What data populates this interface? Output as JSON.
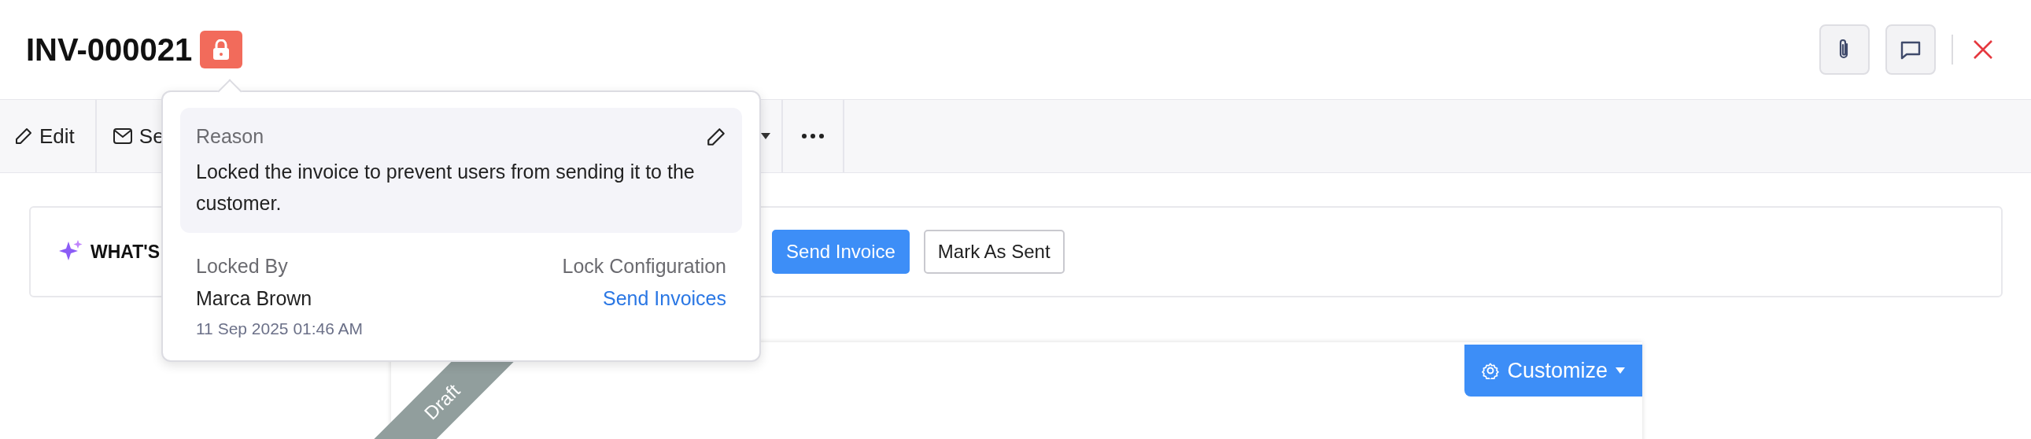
{
  "header": {
    "title": "INV-000021",
    "locked": true
  },
  "toolbar": {
    "items": [
      {
        "kind": "edit",
        "label": "Edit"
      },
      {
        "kind": "send",
        "label": "Se"
      },
      {
        "kind": "caret"
      },
      {
        "kind": "more"
      }
    ]
  },
  "lock_popover": {
    "reason_label": "Reason",
    "reason": "Locked the invoice to prevent users from sending it to the customer.",
    "locked_by_label": "Locked By",
    "locked_by": "Marca Brown",
    "locked_at": "11 Sep 2025 01:46 AM",
    "config_label": "Lock Configuration",
    "config_link": "Send Invoices"
  },
  "banner": {
    "title": "WHAT'S",
    "buttons": [
      {
        "label": "Send Invoice",
        "primary": true
      },
      {
        "label": "Mark As Sent",
        "primary": false
      }
    ]
  },
  "document": {
    "status": "Draft",
    "customize": "Customize"
  }
}
